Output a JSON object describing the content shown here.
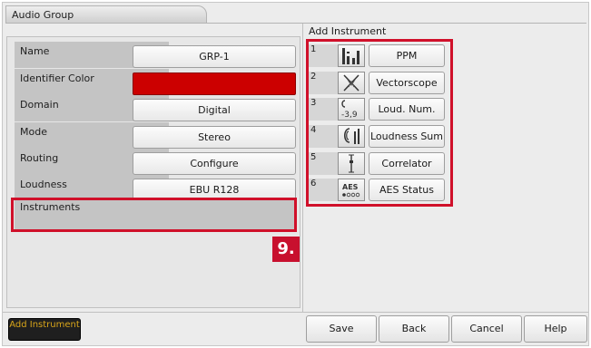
{
  "window": {
    "title": "Audio Group"
  },
  "properties": [
    {
      "label": "Name",
      "value": "GRP-1"
    },
    {
      "label": "Identifier Color",
      "value": ""
    },
    {
      "label": "Domain",
      "value": "Digital"
    },
    {
      "label": "Mode",
      "value": "Stereo"
    },
    {
      "label": "Routing",
      "value": "Configure"
    },
    {
      "label": "Loudness",
      "value": "EBU R128"
    }
  ],
  "identifier_color_hex": "#cc0000",
  "instruments_label": "Instruments",
  "callout_label": "9.",
  "add_instrument": {
    "heading": "Add Instrument",
    "items": [
      {
        "num": "1",
        "label": "PPM",
        "icon": "ppm-meter-icon"
      },
      {
        "num": "2",
        "label": "Vectorscope",
        "icon": "vectorscope-icon"
      },
      {
        "num": "3",
        "label": "Loud. Num.",
        "icon": "loudness-number-icon",
        "icon_text": "-3,9"
      },
      {
        "num": "4",
        "label": "Loudness Sum",
        "icon": "loudness-sum-icon"
      },
      {
        "num": "5",
        "label": "Correlator",
        "icon": "correlator-icon"
      },
      {
        "num": "6",
        "label": "AES Status",
        "icon": "aes-status-icon",
        "icon_text": "AES"
      }
    ]
  },
  "bottom_bar": {
    "add_instrument_label": "Add Instrument",
    "buttons": [
      "Save",
      "Back",
      "Cancel",
      "Help"
    ]
  },
  "colors": {
    "highlight": "#d0102a",
    "callout": "#c8102e",
    "add_instrument_text": "#d8a51a"
  }
}
